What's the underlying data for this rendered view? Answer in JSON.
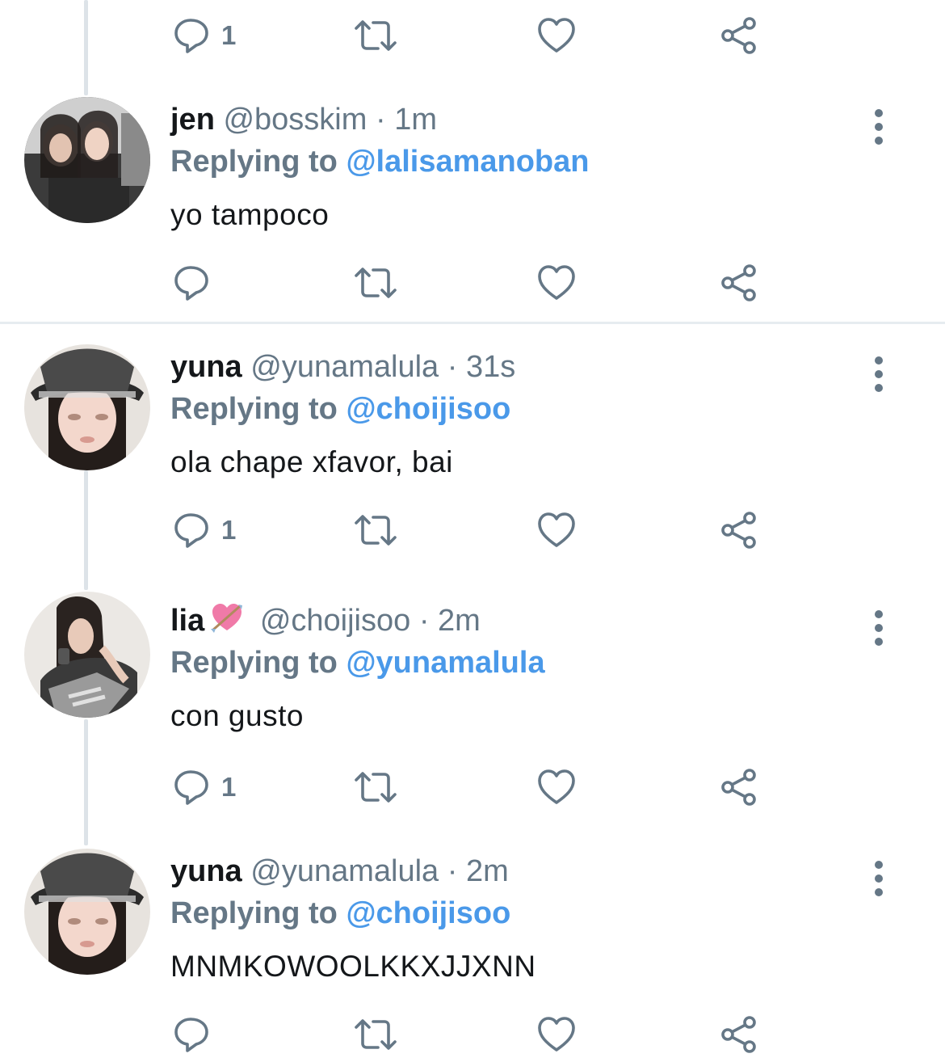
{
  "top_actions": {
    "reply_count": "1"
  },
  "tweets": [
    {
      "name": "jen",
      "handle": "@bosskim",
      "separator": "·",
      "time": "1m",
      "replying_prefix": "Replying to",
      "replying_to": "@lalisamanoban",
      "text": "yo tampoco",
      "reply_count": ""
    },
    {
      "name": "yuna",
      "handle": "@yunamalula",
      "separator": "·",
      "time": "31s",
      "replying_prefix": "Replying to",
      "replying_to": "@choijisoo",
      "text": "ola chape xfavor, bai",
      "reply_count": "1"
    },
    {
      "name": "lia",
      "name_emoji": "heart-with-arrow",
      "handle": "@choijisoo",
      "separator": "·",
      "time": "2m",
      "replying_prefix": "Replying to",
      "replying_to": "@yunamalula",
      "text": "con gusto",
      "reply_count": "1"
    },
    {
      "name": "yuna",
      "handle": "@yunamalula",
      "separator": "·",
      "time": "2m",
      "replying_prefix": "Replying to",
      "replying_to": "@choijisoo",
      "text": "MNMKOWOOLKKXJJXNN",
      "reply_count": ""
    }
  ],
  "icons": {
    "reply": "reply-bubble-icon",
    "retweet": "retweet-icon",
    "like": "heart-icon",
    "share": "share-icon",
    "more": "more-vertical-icon"
  },
  "colors": {
    "icon_gray": "#657786",
    "link_blue": "#4a99e9",
    "thread_line": "#dde3e8",
    "divider": "#e6ecf0"
  }
}
